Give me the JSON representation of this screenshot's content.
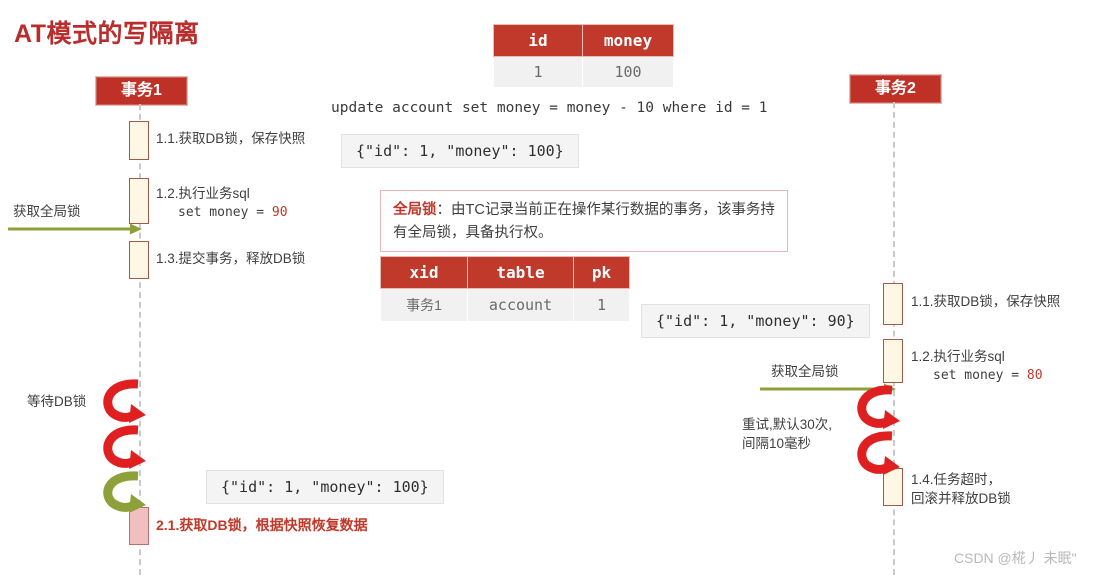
{
  "title": "AT模式的写隔离",
  "watermark": "CSDN @椛丿 未眠\"",
  "sql": "update account set money = money - 10 where id = 1",
  "account_table": {
    "headers": [
      "id",
      "money"
    ],
    "rows": [
      [
        "1",
        "100"
      ]
    ]
  },
  "lock_table": {
    "headers": [
      "xid",
      "table",
      "pk"
    ],
    "rows": [
      [
        "事务1",
        "account",
        "1"
      ]
    ]
  },
  "global_lock_note": {
    "term": "全局锁",
    "text": "：由TC记录当前正在操作某行数据的事务，该事务持有全局锁，具备执行权。"
  },
  "tx1": {
    "header": "事务1",
    "acquire_global_lock": "获取全局锁",
    "wait_db_lock": "等待DB锁",
    "steps": [
      {
        "label": "1.1.获取DB锁，保存快照"
      },
      {
        "label": "1.2.执行业务sql",
        "code": "set money = ",
        "value": "90"
      },
      {
        "label": "1.3.提交事务，释放DB锁"
      },
      {
        "label": "2.1.获取DB锁，根据快照恢复数据"
      }
    ],
    "snapshot_before": "{\"id\": 1, \"money\": 100}",
    "snapshot_restore": "{\"id\": 1, \"money\": 100}"
  },
  "tx2": {
    "header": "事务2",
    "acquire_global_lock": "获取全局锁",
    "retry_note": "重试,默认30次,\n间隔10毫秒",
    "steps": [
      {
        "label": "1.1.获取DB锁，保存快照"
      },
      {
        "label": "1.2.执行业务sql",
        "code": "set money = ",
        "value": "80"
      },
      {
        "label": "1.4.任务超时，\n回滚并释放DB锁"
      }
    ],
    "snapshot_before": "{\"id\": 1, \"money\": 90}"
  },
  "colors": {
    "brand_red": "#bf3126",
    "title_red": "#b92d2d",
    "arrow_red": "#e02020",
    "arrow_olive": "#8ea03a",
    "activation_fill": "#fdf7e3",
    "activation_pink": "#f2bfc0",
    "lifeline_gray": "#c9c9c9"
  }
}
